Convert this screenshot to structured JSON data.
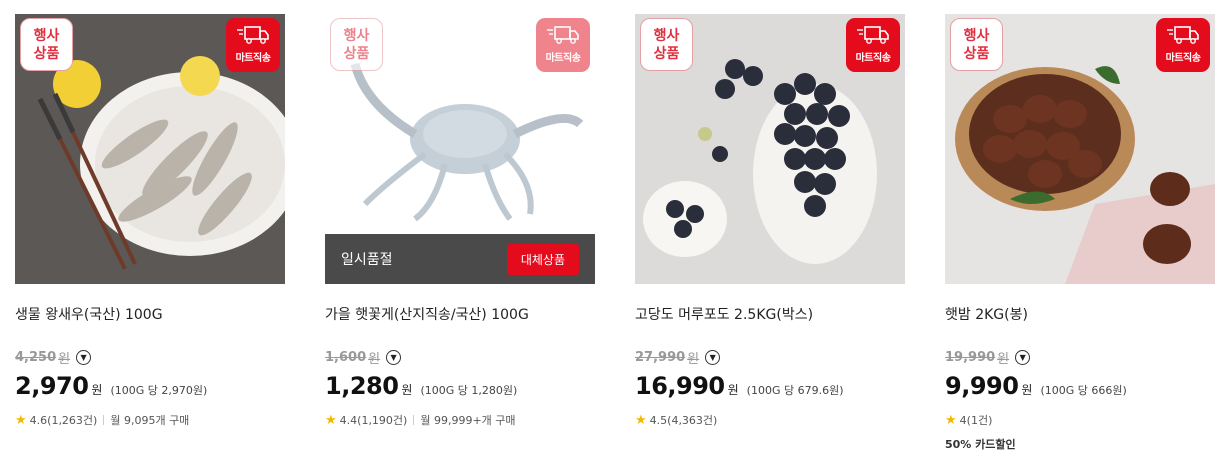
{
  "products": [
    {
      "event_badge": [
        "행사",
        "상품"
      ],
      "direct_badge": "마트직송",
      "title": "생물 왕새우(국산) 100G",
      "original_price": "4,250",
      "original_unit": "원",
      "price": "2,970",
      "price_unit": "원",
      "unit_price": "(100G 당 2,970원)",
      "rating": "4.6(1,263건)",
      "monthly_sales": "월 9,095개 구매"
    },
    {
      "event_badge": [
        "행사",
        "상품"
      ],
      "direct_badge": "마트직송",
      "title": "가을 햇꽃게(산지직송/국산) 100G",
      "original_price": "1,600",
      "original_unit": "원",
      "price": "1,280",
      "price_unit": "원",
      "unit_price": "(100G 당 1,280원)",
      "rating": "4.4(1,190건)",
      "monthly_sales": "월 99,999+개 구매",
      "sold_out_text": "일시품절",
      "substitute_button": "대체상품"
    },
    {
      "event_badge": [
        "행사",
        "상품"
      ],
      "direct_badge": "마트직송",
      "title": "고당도 머루포도 2.5KG(박스)",
      "original_price": "27,990",
      "original_unit": "원",
      "price": "16,990",
      "price_unit": "원",
      "unit_price": "(100G 당 679.6원)",
      "rating": "4.5(4,363건)"
    },
    {
      "event_badge": [
        "행사",
        "상품"
      ],
      "direct_badge": "마트직송",
      "title": "햇밤 2KG(봉)",
      "original_price": "19,990",
      "original_unit": "원",
      "price": "9,990",
      "price_unit": "원",
      "unit_price": "(100G 당 666원)",
      "rating": "4(1건)",
      "card_discount": "50% 카드할인"
    }
  ],
  "icons": {
    "info": "chevron-down-icon",
    "rating": "star-icon",
    "delivery": "truck-icon"
  },
  "colors": {
    "accent": "#e30b1c",
    "star": "#f5b800",
    "soldout_bar": "#4a4a4a"
  }
}
